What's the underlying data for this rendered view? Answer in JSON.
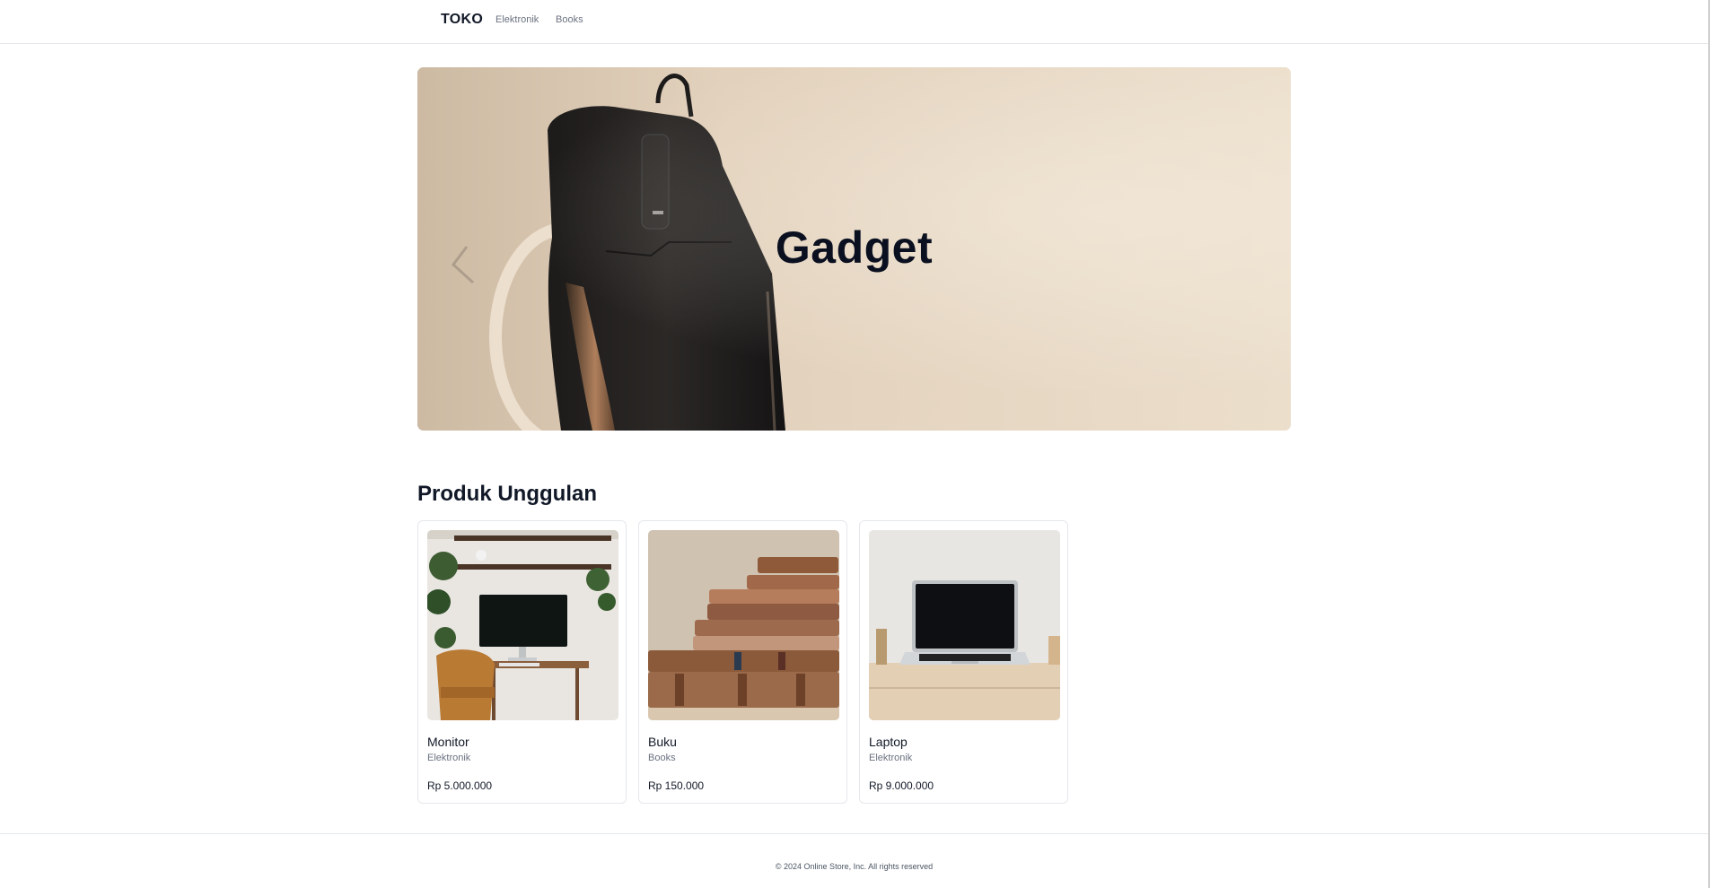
{
  "header": {
    "brand": "TOKO",
    "nav": [
      {
        "label": "Elektronik"
      },
      {
        "label": "Books"
      }
    ]
  },
  "hero": {
    "title": "Gadget"
  },
  "featured": {
    "title": "Produk Unggulan",
    "products": [
      {
        "name": "Monitor",
        "category": "Elektronik",
        "price": "Rp 5.000.000"
      },
      {
        "name": "Buku",
        "category": "Books",
        "price": "Rp 150.000"
      },
      {
        "name": "Laptop",
        "category": "Elektronik",
        "price": "Rp 9.000.000"
      }
    ]
  },
  "footer": {
    "text": "© 2024 Online Store, Inc. All rights reserved"
  }
}
